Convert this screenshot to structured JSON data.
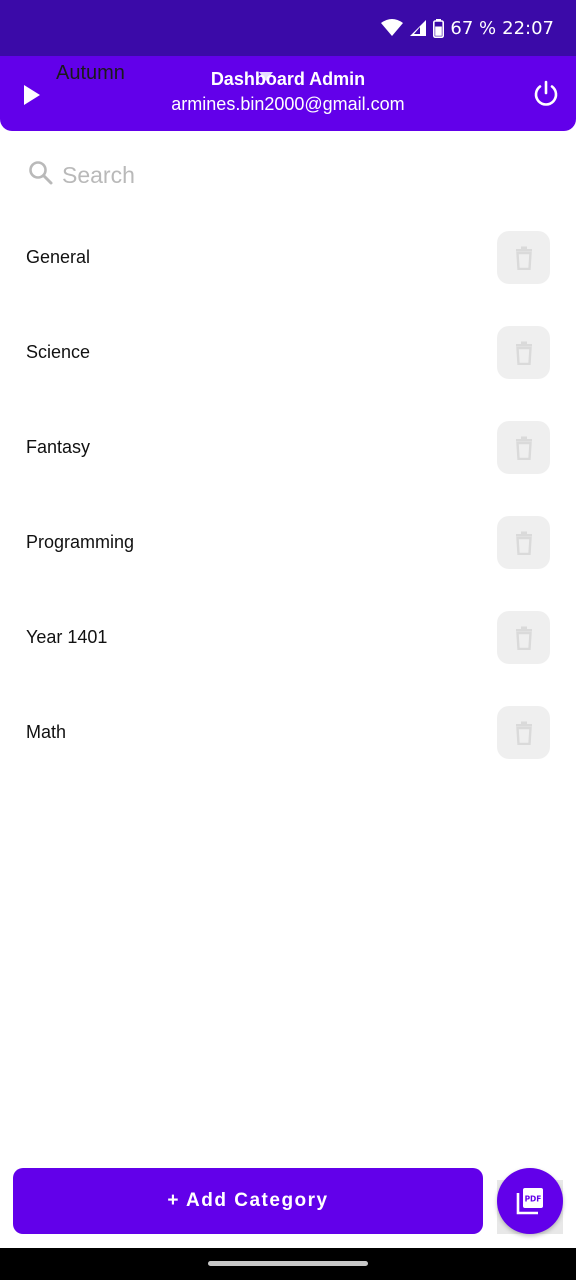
{
  "status_bar": {
    "battery": "67 %",
    "time": "22:07",
    "icons": [
      "wifi-icon",
      "signal-icon",
      "battery-icon"
    ]
  },
  "app_bar": {
    "theme_label": "Autumn",
    "title": "Dashboard Admin",
    "email": "armines.bin2000@gmail.com",
    "icons": [
      "play-icon",
      "dropdown-caret-icon",
      "power-icon"
    ],
    "color": "#6200ea"
  },
  "search": {
    "placeholder": "Search",
    "value": ""
  },
  "categories": [
    {
      "label": "General"
    },
    {
      "label": "Science"
    },
    {
      "label": "Fantasy"
    },
    {
      "label": "Programming"
    },
    {
      "label": "Year 1401"
    },
    {
      "label": "Math"
    }
  ],
  "actions": {
    "add_label": "+ Add Category",
    "pdf_icon": "pdf-icon",
    "delete_icon": "trash-icon"
  },
  "colors": {
    "primary": "#6200ea",
    "status_bar": "#3b0aa8",
    "delete_bg": "#efefef"
  }
}
